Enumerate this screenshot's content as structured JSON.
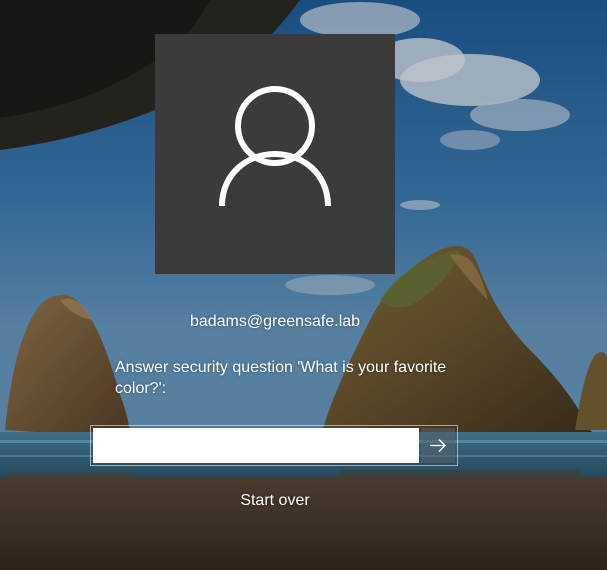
{
  "login": {
    "avatar_icon": "user-icon",
    "username": "badams@greensafe.lab",
    "security_prompt": "Answer security question 'What is your favorite color?':",
    "answer_value": "",
    "submit_icon": "arrow-right-icon",
    "start_over_label": "Start over"
  },
  "colors": {
    "avatar_tile": "#3b3b3b",
    "input_background": "#ffffff",
    "text": "#ffffff"
  }
}
